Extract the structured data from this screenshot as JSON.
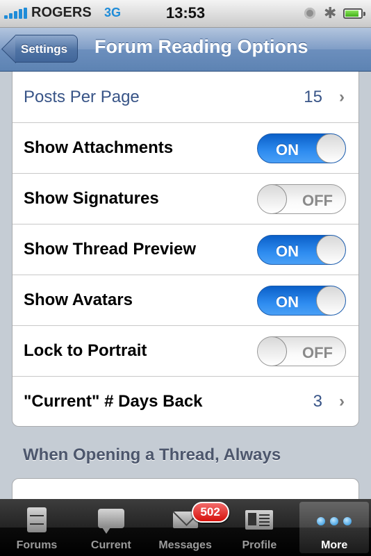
{
  "status_bar": {
    "carrier": "ROGERS",
    "network": "3G",
    "time": "13:53",
    "battery_level": 0.8
  },
  "nav_bar": {
    "back_label": "Settings",
    "title": "Forum Reading Options"
  },
  "settings": [
    {
      "label": "Posts Per Page",
      "type": "disclosure",
      "value": "15"
    },
    {
      "label": "Show Attachments",
      "type": "switch",
      "state": "ON"
    },
    {
      "label": "Show Signatures",
      "type": "switch",
      "state": "OFF"
    },
    {
      "label": "Show Thread Preview",
      "type": "switch",
      "state": "ON"
    },
    {
      "label": "Show Avatars",
      "type": "switch",
      "state": "ON"
    },
    {
      "label": "Lock to Portrait",
      "type": "switch",
      "state": "OFF"
    },
    {
      "label": "\"Current\" # Days Back",
      "type": "disclosure",
      "value": "3"
    }
  ],
  "section_header": "When Opening a Thread, Always",
  "tab_bar": {
    "tabs": [
      {
        "label": "Forums",
        "icon": "file-cabinet-icon"
      },
      {
        "label": "Current",
        "icon": "speech-bubble-icon"
      },
      {
        "label": "Messages",
        "icon": "envelope-icon",
        "badge": "502"
      },
      {
        "label": "Profile",
        "icon": "id-card-icon"
      },
      {
        "label": "More",
        "icon": "more-dots-icon",
        "active": true
      }
    ]
  },
  "colors": {
    "nav_blue": "#6c8fbd",
    "switch_on": "#2e8cf0",
    "value_blue": "#385487",
    "badge_red": "#d6110b",
    "grouped_background": "#c5ccd4"
  }
}
